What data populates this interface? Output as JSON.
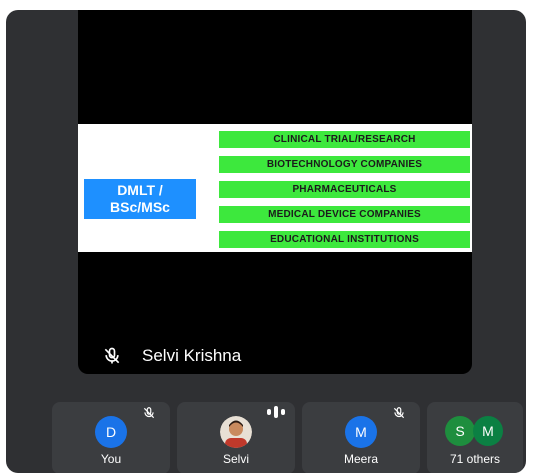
{
  "stage": {
    "slide": {
      "degree_line1": "DMLT /",
      "degree_line2": "BSc/MSc",
      "careers": [
        "CLINICAL TRIAL/RESEARCH",
        "BIOTECHNOLOGY COMPANIES",
        "PHARMACEUTICALS",
        "MEDICAL DEVICE COMPANIES",
        "EDUCATIONAL INSTITUTIONS"
      ]
    },
    "speaker_name": "Selvi Krishna",
    "speaker_muted": true
  },
  "participants": [
    {
      "initial": "D",
      "name": "You",
      "muted": true,
      "avatar_color": "#1a73e8"
    },
    {
      "name": "Selvi",
      "speaking": true,
      "avatar": "photo"
    },
    {
      "initial": "M",
      "name": "Meera",
      "muted": true,
      "avatar_color": "#1a73e8"
    },
    {
      "initials": [
        "S",
        "M"
      ],
      "name": "71 others",
      "avatar_colors": [
        "#1e8e3e",
        "#0b8043"
      ]
    }
  ],
  "colors": {
    "background": "#2f3033",
    "tile": "#3b3d40",
    "career_box": "#3de83d",
    "degree_box": "#1e90ff"
  }
}
